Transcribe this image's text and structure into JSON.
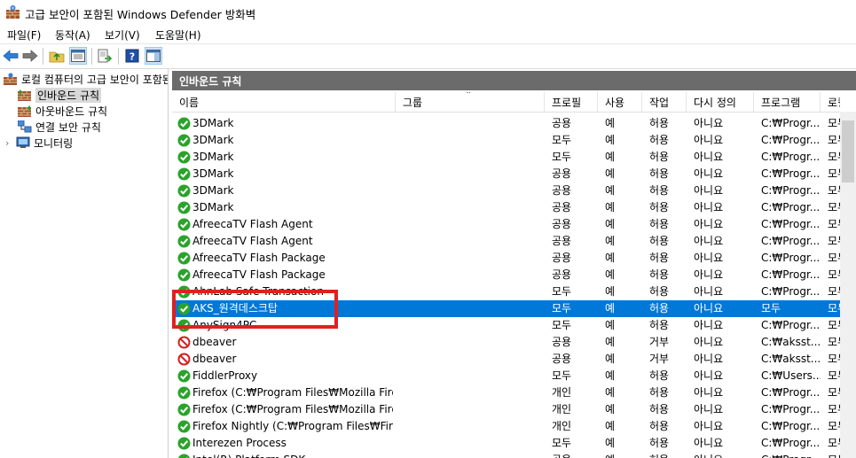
{
  "window": {
    "title": "고급 보안이 포함된 Windows Defender 방화벽",
    "icon": "firewall-icon"
  },
  "menu": [
    "파일(F)",
    "동작(A)",
    "보기(V)",
    "도움말(H)"
  ],
  "toolbar": [
    "back-arrow-icon",
    "forward-arrow-icon",
    "up-folder-icon",
    "show-hide-tree-icon",
    "export-icon",
    "help-icon",
    "panel-icon"
  ],
  "tree": {
    "root": "로컬 컴퓨터의 고급 보안이 포함된 Windows Defender 방화벽",
    "items": [
      "인바운드 규칙",
      "아웃바운드 규칙",
      "연결 보안 규칙",
      "모니터링"
    ]
  },
  "pane": {
    "title": "인바운드 규칙"
  },
  "columns": [
    "이름",
    "그룹",
    "프로필",
    "사용",
    "작업",
    "다시 정의",
    "프로그램",
    "로컬"
  ],
  "rows": [
    {
      "name": "3DMark",
      "group": "",
      "profile": "공용",
      "enabled": "예",
      "action": "허용",
      "override": "아니요",
      "program": "C:₩Progr...",
      "local": "모두",
      "status": "allow"
    },
    {
      "name": "3DMark",
      "group": "",
      "profile": "모두",
      "enabled": "예",
      "action": "허용",
      "override": "아니요",
      "program": "C:₩Progr...",
      "local": "모두",
      "status": "allow"
    },
    {
      "name": "3DMark",
      "group": "",
      "profile": "모두",
      "enabled": "예",
      "action": "허용",
      "override": "아니요",
      "program": "C:₩Progr...",
      "local": "모두",
      "status": "allow"
    },
    {
      "name": "3DMark",
      "group": "",
      "profile": "공용",
      "enabled": "예",
      "action": "허용",
      "override": "아니요",
      "program": "C:₩Progr...",
      "local": "모두",
      "status": "allow"
    },
    {
      "name": "3DMark",
      "group": "",
      "profile": "공용",
      "enabled": "예",
      "action": "허용",
      "override": "아니요",
      "program": "C:₩Progr...",
      "local": "모두",
      "status": "allow"
    },
    {
      "name": "3DMark",
      "group": "",
      "profile": "공용",
      "enabled": "예",
      "action": "허용",
      "override": "아니요",
      "program": "C:₩Progr...",
      "local": "모두",
      "status": "allow"
    },
    {
      "name": "AfreecaTV Flash Agent",
      "group": "",
      "profile": "공용",
      "enabled": "예",
      "action": "허용",
      "override": "아니요",
      "program": "C:₩Progr...",
      "local": "모두",
      "status": "allow"
    },
    {
      "name": "AfreecaTV Flash Agent",
      "group": "",
      "profile": "공용",
      "enabled": "예",
      "action": "허용",
      "override": "아니요",
      "program": "C:₩Progr...",
      "local": "모두",
      "status": "allow"
    },
    {
      "name": "AfreecaTV Flash Package",
      "group": "",
      "profile": "공용",
      "enabled": "예",
      "action": "허용",
      "override": "아니요",
      "program": "C:₩Progr...",
      "local": "모두",
      "status": "allow"
    },
    {
      "name": "AfreecaTV Flash Package",
      "group": "",
      "profile": "공용",
      "enabled": "예",
      "action": "허용",
      "override": "아니요",
      "program": "C:₩Progr...",
      "local": "모두",
      "status": "allow"
    },
    {
      "name": "AhnLab Safe Transaction",
      "group": "",
      "profile": "모두",
      "enabled": "예",
      "action": "허용",
      "override": "아니요",
      "program": "C:₩Progr...",
      "local": "모두",
      "status": "allow"
    },
    {
      "name": "AKS_원격데스크탑",
      "group": "",
      "profile": "모두",
      "enabled": "예",
      "action": "허용",
      "override": "아니요",
      "program": "모두",
      "local": "모두",
      "status": "allow",
      "selected": true
    },
    {
      "name": "AnySign4PC",
      "group": "",
      "profile": "모두",
      "enabled": "예",
      "action": "허용",
      "override": "아니요",
      "program": "C:₩Progr...",
      "local": "모두",
      "status": "allow"
    },
    {
      "name": "dbeaver",
      "group": "",
      "profile": "공용",
      "enabled": "예",
      "action": "거부",
      "override": "아니요",
      "program": "C:₩aksst...",
      "local": "모두",
      "status": "block"
    },
    {
      "name": "dbeaver",
      "group": "",
      "profile": "공용",
      "enabled": "예",
      "action": "거부",
      "override": "아니요",
      "program": "C:₩aksst...",
      "local": "모두",
      "status": "block"
    },
    {
      "name": "FiddlerProxy",
      "group": "",
      "profile": "모두",
      "enabled": "예",
      "action": "허용",
      "override": "아니요",
      "program": "C:₩Users...",
      "local": "모두",
      "status": "allow"
    },
    {
      "name": "Firefox (C:₩Program Files₩Mozilla Firef...",
      "group": "",
      "profile": "개인",
      "enabled": "예",
      "action": "허용",
      "override": "아니요",
      "program": "C:₩Progr...",
      "local": "모두",
      "status": "allow"
    },
    {
      "name": "Firefox (C:₩Program Files₩Mozilla Firef...",
      "group": "",
      "profile": "개인",
      "enabled": "예",
      "action": "허용",
      "override": "아니요",
      "program": "C:₩Progr...",
      "local": "모두",
      "status": "allow"
    },
    {
      "name": "Firefox Nightly (C:₩Program Files₩Firef...",
      "group": "",
      "profile": "개인",
      "enabled": "예",
      "action": "허용",
      "override": "아니요",
      "program": "C:₩Progr...",
      "local": "모두",
      "status": "allow"
    },
    {
      "name": "Interezen Process",
      "group": "",
      "profile": "모두",
      "enabled": "예",
      "action": "허용",
      "override": "아니요",
      "program": "C:₩Progr...",
      "local": "모두",
      "status": "allow"
    },
    {
      "name": "Intel(R) Platform SDK",
      "group": "",
      "profile": "공용",
      "enabled": "예",
      "action": "허용",
      "override": "아니요",
      "program": "C:₩Progr...",
      "local": "모두",
      "status": "allow"
    }
  ],
  "colors": {
    "selected_row": "#0078d7",
    "header_bg": "#6b6b6b",
    "allow_green": "#2aa32a",
    "block_red": "#d42020",
    "annotation": "#e02020"
  }
}
